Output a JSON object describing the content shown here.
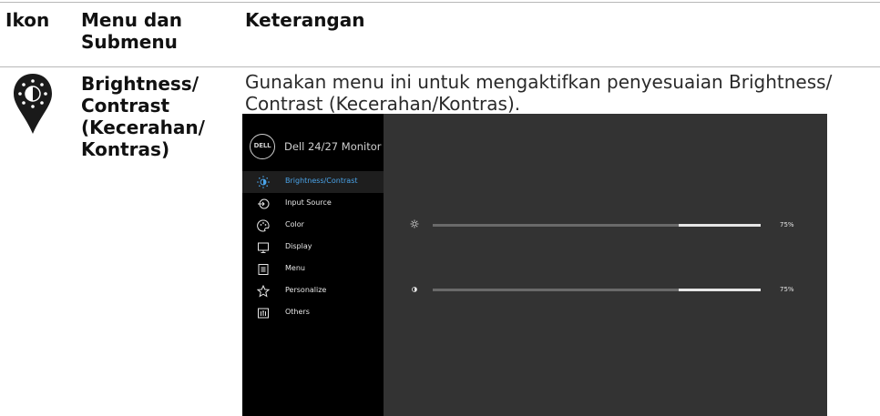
{
  "table": {
    "headers": {
      "icon": "Ikon",
      "menu": "Menu dan Submenu",
      "description": "Keterangan"
    },
    "row": {
      "icon_name": "brightness-contrast-icon",
      "menu_label": "Brightness/ Contrast (Kecerahan/ Kontras)",
      "description": "Gunakan menu ini untuk mengaktifkan penyesuaian Brightness/ Contrast (Kecerahan/Kontras)."
    }
  },
  "osd": {
    "logo_text": "DELL",
    "title": "Dell 24/27 Monitor",
    "menu_items": [
      {
        "label": "Brightness/Contrast",
        "icon": "brightness-contrast-icon",
        "selected": true
      },
      {
        "label": "Input Source",
        "icon": "input-source-icon",
        "selected": false
      },
      {
        "label": "Color",
        "icon": "color-palette-icon",
        "selected": false
      },
      {
        "label": "Display",
        "icon": "display-icon",
        "selected": false
      },
      {
        "label": "Menu",
        "icon": "menu-icon",
        "selected": false
      },
      {
        "label": "Personalize",
        "icon": "star-icon",
        "selected": false
      },
      {
        "label": "Others",
        "icon": "others-icon",
        "selected": false
      }
    ],
    "sliders": [
      {
        "name": "brightness",
        "icon": "sun-icon",
        "value": 75,
        "value_label": "75%"
      },
      {
        "name": "contrast",
        "icon": "contrast-icon",
        "value": 75,
        "value_label": "75%"
      }
    ],
    "colors": {
      "selected_text": "#4aa3e8",
      "panel_bg": "#333333",
      "sidebar_bg": "#000000",
      "slider_track": "#e6e6e6",
      "slider_fill": "#6a6a6a"
    }
  }
}
